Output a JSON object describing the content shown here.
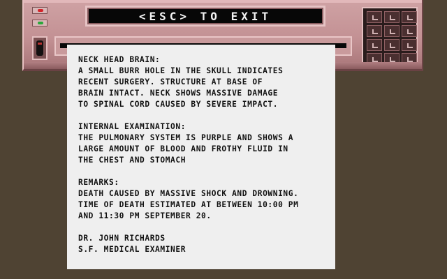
{
  "display": {
    "exit_text": "<ESC> TO EXIT"
  },
  "report": {
    "sections": [
      {
        "lines": [
          "NECK HEAD BRAIN:",
          "A SMALL BURR HOLE IN THE SKULL INDICATES",
          "RECENT SURGERY. STRUCTURE AT BASE OF",
          "BRAIN INTACT. NECK SHOWS MASSIVE DAMAGE",
          "TO SPINAL CORD CAUSED BY SEVERE IMPACT."
        ]
      },
      {
        "lines": [
          "INTERNAL EXAMINATION:",
          "THE PULMONARY SYSTEM IS PURPLE AND SHOWS A",
          "LARGE AMOUNT OF BLOOD AND FROTHY FLUID IN",
          "THE CHEST AND STOMACH"
        ]
      },
      {
        "lines": [
          "REMARKS:",
          "DEATH CAUSED BY MASSIVE SHOCK AND DROWNING.",
          "TIME OF DEATH ESTIMATED AT BETWEEN 10:00 PM",
          "AND 11:30 PM SEPTEMBER 20."
        ]
      },
      {
        "lines": [
          "DR. JOHN RICHARDS",
          "S.F. MEDICAL EXAMINER"
        ]
      }
    ]
  },
  "indicators": [
    {
      "name": "red-indicator-light",
      "color": "#d4242a"
    },
    {
      "name": "green-indicator-light",
      "color": "#2aa83a"
    }
  ],
  "colors": {
    "background": "#4f4333",
    "console": "#c39194",
    "paper": "#efefef",
    "display": "#070707"
  }
}
